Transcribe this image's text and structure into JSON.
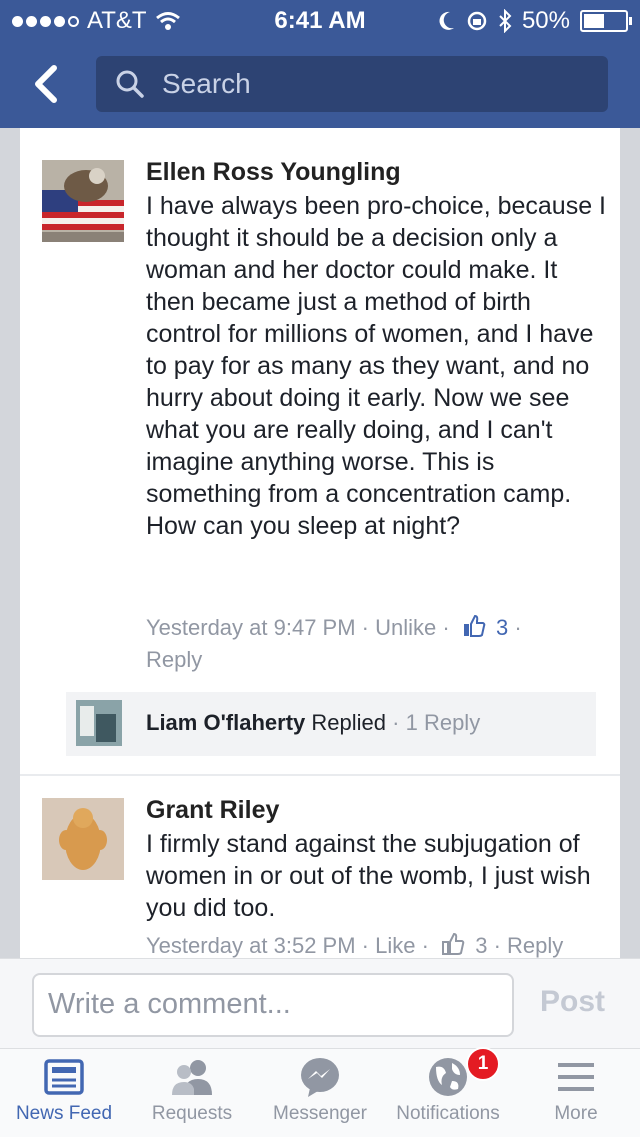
{
  "status_bar": {
    "carrier": "AT&T",
    "time": "6:41 AM",
    "battery": "50%",
    "battery_level": 0.5
  },
  "nav": {
    "search_placeholder": "Search"
  },
  "comments": [
    {
      "author": "Ellen Ross Youngling",
      "text": "I have always been pro-choice, because I thought it should be a decision only a woman and her doctor could make. It then became just a method of birth control for millions of women, and I have to pay for as many as they want, and no hurry about doing it early. Now we see what you are really doing, and I can't imagine anything worse. This is something from a concentration camp. How can you sleep at night?",
      "time": "Yesterday at 9:47 PM",
      "like_action": "Unlike",
      "like_count": "3",
      "reply_action": "Reply",
      "reply_preview": {
        "name": "Liam O'flaherty",
        "action": "Replied",
        "count": "1 Reply"
      }
    },
    {
      "author": "Grant Riley",
      "text": "I firmly stand against the subjugation of women in or out of the womb, I just wish you did too.",
      "time": "Yesterday at 3:52 PM",
      "like_action": "Like",
      "like_count": "3",
      "reply_action": "Reply"
    }
  ],
  "composer": {
    "placeholder": "Write a comment...",
    "post_label": "Post"
  },
  "tabs": [
    {
      "label": "News Feed",
      "icon": "news-feed-icon",
      "active": true
    },
    {
      "label": "Requests",
      "icon": "friend-requests-icon"
    },
    {
      "label": "Messenger",
      "icon": "messenger-icon"
    },
    {
      "label": "Notifications",
      "icon": "globe-icon",
      "badge": "1"
    },
    {
      "label": "More",
      "icon": "hamburger-menu-icon"
    }
  ],
  "colors": {
    "brand": "#3b5998",
    "active_tab": "#4267b2",
    "badge": "#e41b23"
  }
}
